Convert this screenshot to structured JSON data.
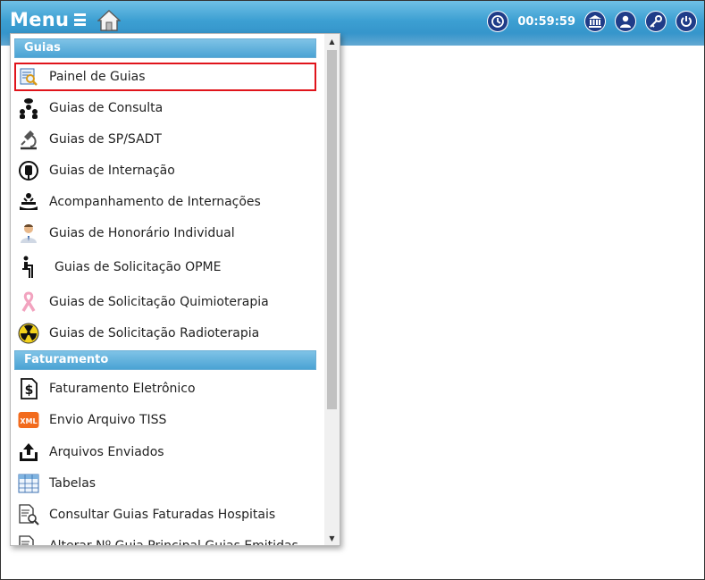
{
  "header": {
    "menu_label": "Menu",
    "timer": "00:59:59",
    "icons": [
      "clock-icon",
      "bank-icon",
      "user-icon",
      "key-icon",
      "power-icon"
    ]
  },
  "menu": {
    "sections": [
      {
        "title": "Guias",
        "items": [
          {
            "label": "Painel de Guias",
            "icon": "panel-search-icon",
            "selected": true
          },
          {
            "label": "Guias de Consulta",
            "icon": "people-icon"
          },
          {
            "label": "Guias de SP/SADT",
            "icon": "microscope-icon"
          },
          {
            "label": "Guias de Internação",
            "icon": "blood-bag-icon"
          },
          {
            "label": "Acompanhamento de Internações",
            "icon": "patient-bed-icon"
          },
          {
            "label": "Guias de Honorário Individual",
            "icon": "doctor-icon"
          },
          {
            "label": "Guias de Solicitação OPME",
            "icon": "wheelchair-icon"
          },
          {
            "label": "Guias de Solicitação Quimioterapia",
            "icon": "ribbon-icon"
          },
          {
            "label": "Guias de Solicitação Radioterapia",
            "icon": "radiation-icon"
          }
        ]
      },
      {
        "title": "Faturamento",
        "items": [
          {
            "label": "Faturamento Eletrônico",
            "icon": "dollar-document-icon"
          },
          {
            "label": "Envio Arquivo TISS",
            "icon": "xml-icon"
          },
          {
            "label": "Arquivos Enviados",
            "icon": "upload-tray-icon"
          },
          {
            "label": "Tabelas",
            "icon": "table-icon"
          },
          {
            "label": "Consultar Guias Faturadas Hospitais",
            "icon": "document-search-icon"
          },
          {
            "label": "Alterar Nº Guia Principal Guias Emitidas",
            "icon": "document-edit-icon"
          }
        ]
      }
    ]
  },
  "colors": {
    "accent": "#2f8cc4",
    "selected_border": "#e0141b",
    "dark_icon": "#1f3c88"
  }
}
